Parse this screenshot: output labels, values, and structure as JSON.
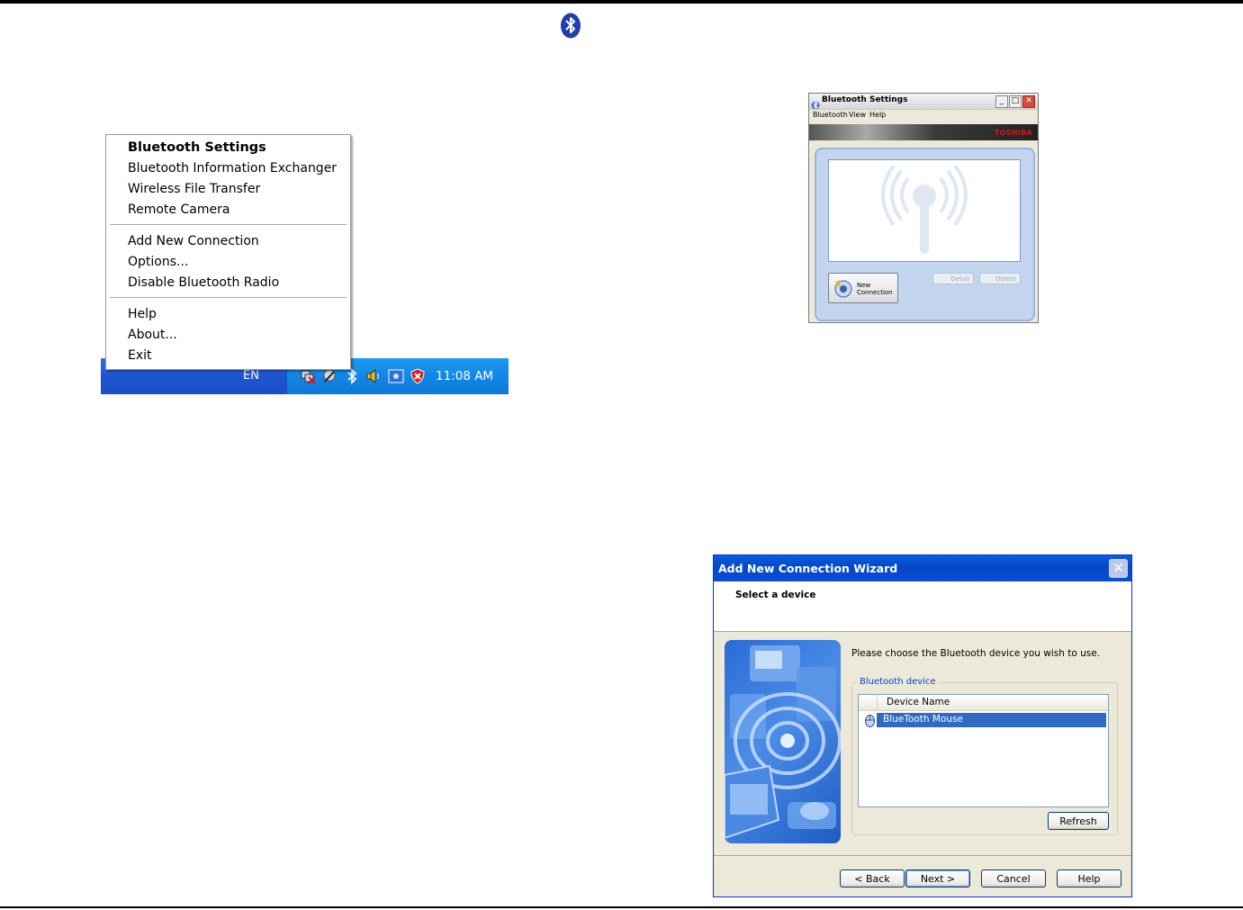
{
  "context_menu": {
    "items": [
      {
        "label": "Bluetooth Settings",
        "bold": true
      },
      {
        "label": "Bluetooth Information Exchanger"
      },
      {
        "label": "Wireless File Transfer"
      },
      {
        "label": "Remote Camera"
      },
      {
        "label": "Add New Connection"
      },
      {
        "label": "Options..."
      },
      {
        "label": "Disable Bluetooth Radio"
      },
      {
        "label": "Help"
      },
      {
        "label": "About..."
      },
      {
        "label": "Exit"
      }
    ]
  },
  "taskbar": {
    "language": "EN",
    "clock": "11:08 AM",
    "tray_icons": [
      "network-disconnected-icon",
      "tray-app-icon",
      "bluetooth-icon",
      "volume-icon",
      "display-icon",
      "security-shield-icon"
    ]
  },
  "bt_settings_window": {
    "title": "Bluetooth Settings",
    "menu": [
      "Bluetooth",
      "View",
      "Help"
    ],
    "brand": "TOSHIBA",
    "new_connection_label": [
      "New",
      "Connection"
    ],
    "detail_label": "Detail",
    "delete_label": "Delete"
  },
  "wizard": {
    "title": "Add New Connection Wizard",
    "step_heading": "Select a device",
    "prompt": "Please choose the Bluetooth device you wish to use.",
    "group_label": "Bluetooth device",
    "column_header": "Device Name",
    "devices": [
      "BlueTooth Mouse"
    ],
    "refresh_label": "Refresh",
    "buttons": {
      "back": "< Back",
      "next": "Next >",
      "cancel": "Cancel",
      "help": "Help"
    }
  },
  "colors": {
    "taskbar": "#1f55d0",
    "tray": "#1287e6",
    "selection": "#316ac5",
    "xp_title": "#0446c8",
    "brand": "#d01818"
  }
}
